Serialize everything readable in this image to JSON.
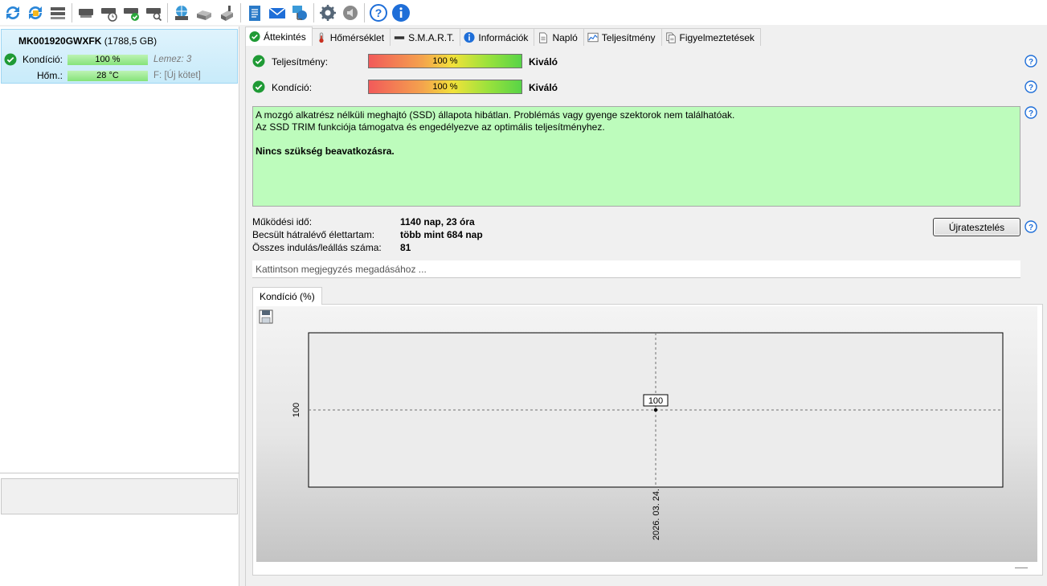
{
  "disk": {
    "model": "MK001920GWXFK",
    "size": "(1788,5 GB)",
    "condition_label": "Kondíció:",
    "condition_value": "100 %",
    "disk_info": "Lemez: 3",
    "temp_label": "Hőm.:",
    "temp_value": "28 °C",
    "volume_prefix": "F:",
    "volume_name": "[Új kötet]"
  },
  "tabs": [
    {
      "label": "Áttekintés",
      "icon": "check-icon"
    },
    {
      "label": "Hőmérséklet",
      "icon": "thermometer-icon"
    },
    {
      "label": "S.M.A.R.T.",
      "icon": "drive-icon"
    },
    {
      "label": "Információk",
      "icon": "info-icon"
    },
    {
      "label": "Napló",
      "icon": "document-icon"
    },
    {
      "label": "Teljesítmény",
      "icon": "chart-icon"
    },
    {
      "label": "Figyelmeztetések",
      "icon": "alerts-icon"
    }
  ],
  "overview": {
    "performance_label": "Teljesítmény:",
    "performance_value": "100 %",
    "performance_rating": "Kiváló",
    "condition_label": "Kondíció:",
    "condition_value": "100 %",
    "condition_rating": "Kiváló",
    "status_line1": "A mozgó alkatrész nélküli meghajtó (SSD) állapota hibátlan. Problémás vagy gyenge szektorok nem találhatóak.",
    "status_line2": "Az SSD TRIM funkciója támogatva és engedélyezve az optimális teljesítményhez.",
    "status_action": "Nincs szükség beavatkozásra.",
    "uptime_label": "Működési idő:",
    "uptime_value": "1140 nap, 23 óra",
    "remaining_label": "Becsült hátralévő élettartam:",
    "remaining_value": "több mint 684 nap",
    "startstop_label": "Összes indulás/leállás száma:",
    "startstop_value": "81",
    "retest_label": "Újratesztelés",
    "note_placeholder": "Kattintson megjegyzés megadásához ..."
  },
  "chart_tab_label": "Kondíció  (%)",
  "colors": {
    "selection_bg": "#c8ebfa",
    "status_bg": "#bdfcbc",
    "good_green": "#86e37a",
    "accent_blue": "#1e6ed8"
  },
  "chart_data": {
    "type": "line",
    "title": "",
    "xlabel": "",
    "ylabel": "",
    "x": [
      "2026. 03. 24."
    ],
    "series": [
      {
        "values": [
          100
        ]
      }
    ],
    "data_labels": [
      "100"
    ],
    "y_ticks": [
      "100"
    ],
    "ylim": [
      99,
      101
    ],
    "grid": true
  }
}
